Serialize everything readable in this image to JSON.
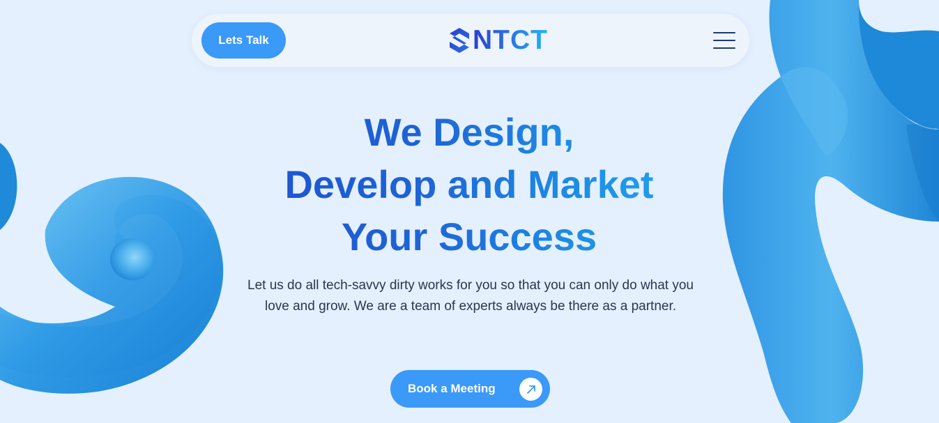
{
  "header": {
    "cta_label": "Lets Talk",
    "logo_text": "NTCT",
    "menu_icon": "hamburger-menu-icon"
  },
  "hero": {
    "title_lines": [
      "We Design,",
      "Develop and Market",
      "Your Success"
    ],
    "description": "Let us do all tech-savvy dirty works for you so that you can only do what you love and grow. We are a team of experts always be there as a partner.",
    "button_label": "Book a Meeting",
    "button_icon": "arrow-up-right-icon"
  },
  "colors": {
    "background": "#e4f0fe",
    "accent": "#3b99f8",
    "heading_start": "#1d52cf",
    "heading_end": "#25a6ef",
    "text": "#2a3550"
  }
}
